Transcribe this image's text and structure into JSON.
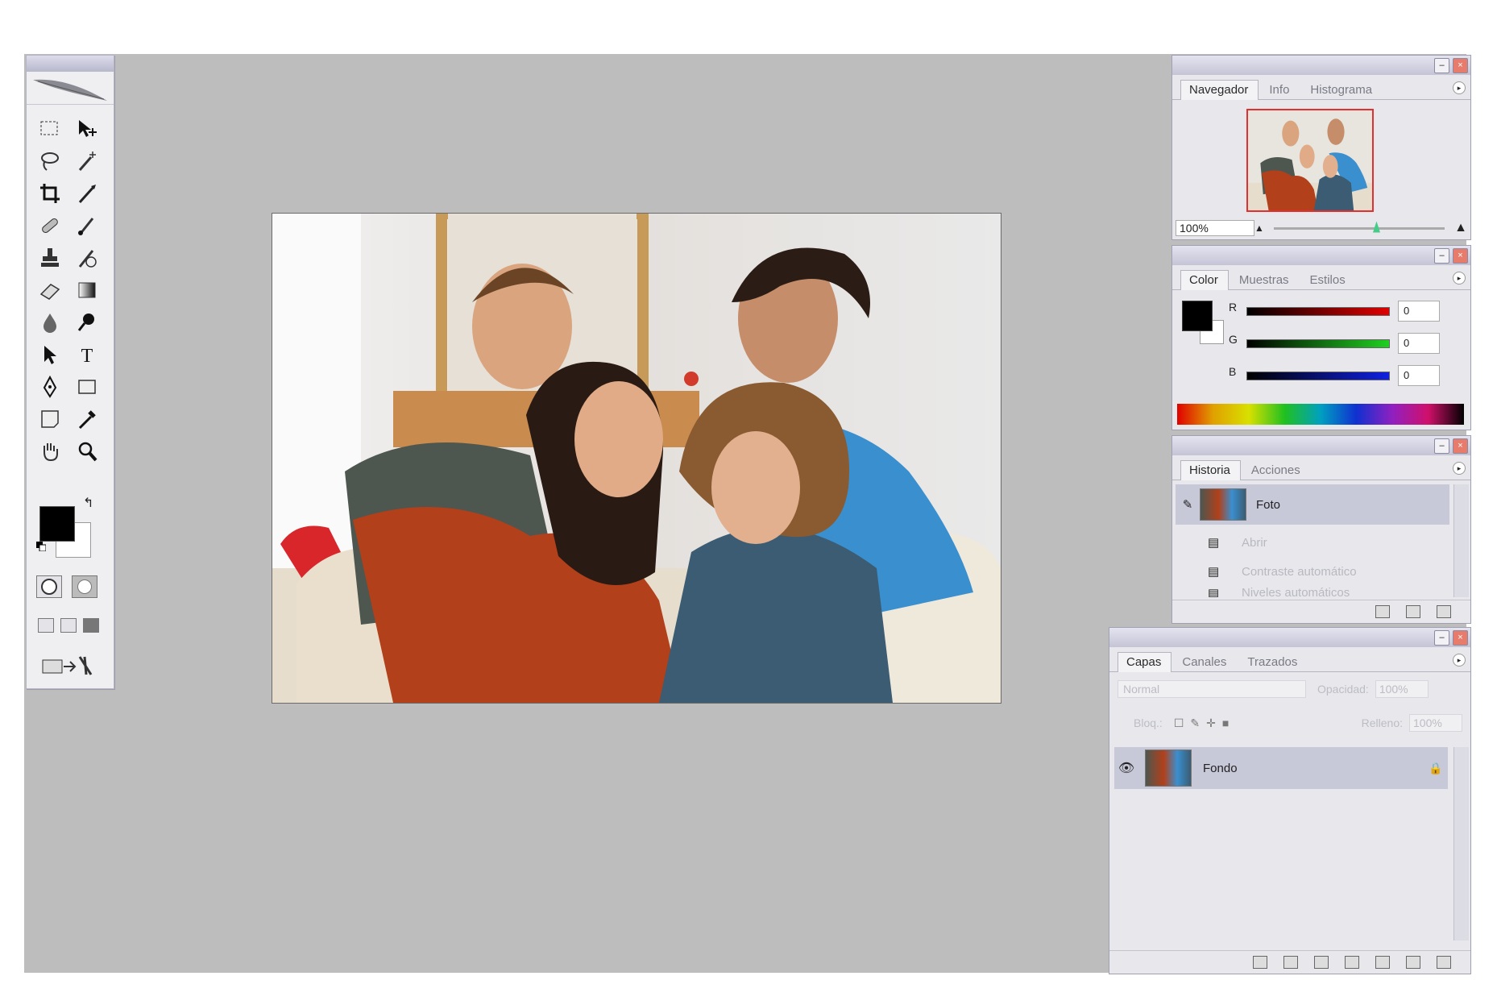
{
  "toolbox": {
    "tools": [
      "marquee-tool",
      "move-tool",
      "lasso-tool",
      "magic-wand-tool",
      "crop-tool",
      "slice-tool",
      "healing-brush-tool",
      "brush-tool",
      "clone-stamp-tool",
      "history-brush-tool",
      "eraser-tool",
      "gradient-tool",
      "blur-tool",
      "dodge-tool",
      "path-selection-tool",
      "type-tool",
      "pen-tool",
      "shape-tool",
      "notes-tool",
      "eyedropper-tool",
      "hand-tool",
      "zoom-tool"
    ],
    "foreground_color": "#000000",
    "background_color": "#ffffff"
  },
  "navigator": {
    "tabs": [
      "Navegador",
      "Info",
      "Histograma"
    ],
    "zoom_value": "100%",
    "zoom_slider_level": 0.58
  },
  "color": {
    "tabs": [
      "Color",
      "Muestras",
      "Estilos"
    ],
    "channels": [
      {
        "label": "R",
        "value": "0",
        "bar": "linear-gradient(to right,#000,#e00000)"
      },
      {
        "label": "G",
        "value": "0",
        "bar": "linear-gradient(to right,#000,#20d020)"
      },
      {
        "label": "B",
        "value": "0",
        "bar": "linear-gradient(to right,#000,#1020e0)"
      }
    ]
  },
  "history": {
    "tabs": [
      "Historia",
      "Acciones"
    ],
    "snapshot_label": "Foto",
    "steps": [
      "Abrir",
      "Contraste automático",
      "Niveles automáticos"
    ]
  },
  "layers": {
    "tabs": [
      "Capas",
      "Canales",
      "Trazados"
    ],
    "blend_mode": "Normal",
    "opacity_label": "Opacidad:",
    "opacity_value": "100%",
    "lock_label": "Bloq.:",
    "fill_label": "Relleno:",
    "fill_value": "100%",
    "items": [
      {
        "name": "Fondo",
        "visible": true,
        "locked": true
      }
    ]
  }
}
